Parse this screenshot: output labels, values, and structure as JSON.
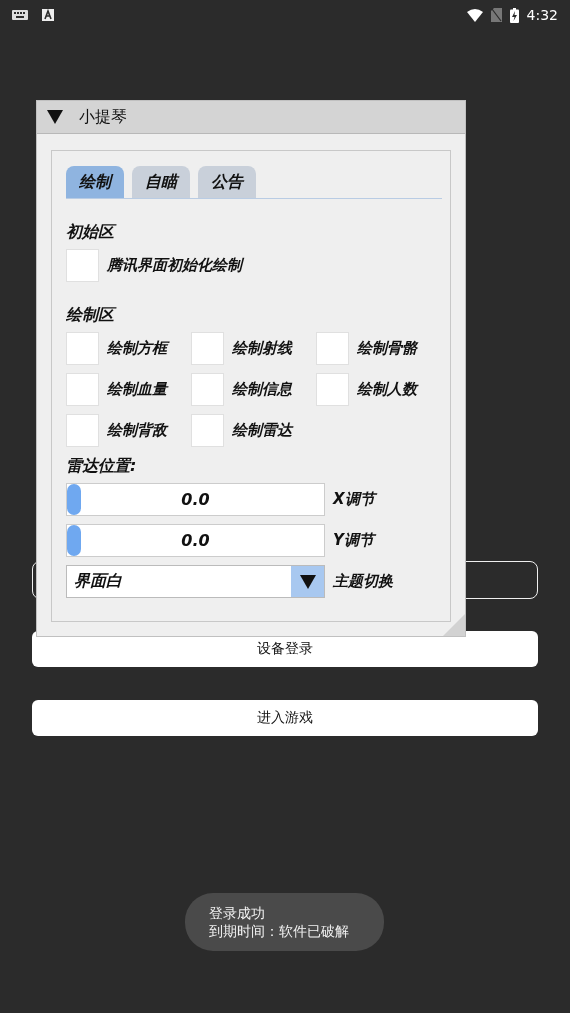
{
  "status_bar": {
    "time": "4:32"
  },
  "window": {
    "title": "小提琴",
    "expanded": true,
    "tabs": [
      {
        "label": "绘制",
        "selected": true
      },
      {
        "label": "自瞄",
        "selected": false
      },
      {
        "label": "公告",
        "selected": false
      }
    ],
    "sections": [
      {
        "title": "初始区",
        "checkboxes": [
          {
            "label": "腾讯界面初始化绘制",
            "checked": false
          }
        ]
      },
      {
        "title": "绘制区",
        "checkboxes": [
          {
            "label": "绘制方框",
            "checked": false
          },
          {
            "label": "绘制射线",
            "checked": false
          },
          {
            "label": "绘制骨骼",
            "checked": false
          },
          {
            "label": "绘制血量",
            "checked": false
          },
          {
            "label": "绘制信息",
            "checked": false
          },
          {
            "label": "绘制人数",
            "checked": false
          },
          {
            "label": "绘制背敌",
            "checked": false
          },
          {
            "label": "绘制雷达",
            "checked": false
          }
        ]
      }
    ],
    "radar_label": "雷达位置:",
    "sliders": [
      {
        "value": "0.0",
        "label": "X调节",
        "level": 0
      },
      {
        "value": "0.0",
        "label": "Y调节",
        "level": 0
      }
    ],
    "theme_select": {
      "value": "界面白",
      "label": "主题切换"
    }
  },
  "buttons": [
    {
      "label": "设备登录"
    },
    {
      "label": "进入游戏"
    }
  ],
  "toast": {
    "lines": [
      "登录成功",
      "到期时间：软件已破解"
    ]
  }
}
